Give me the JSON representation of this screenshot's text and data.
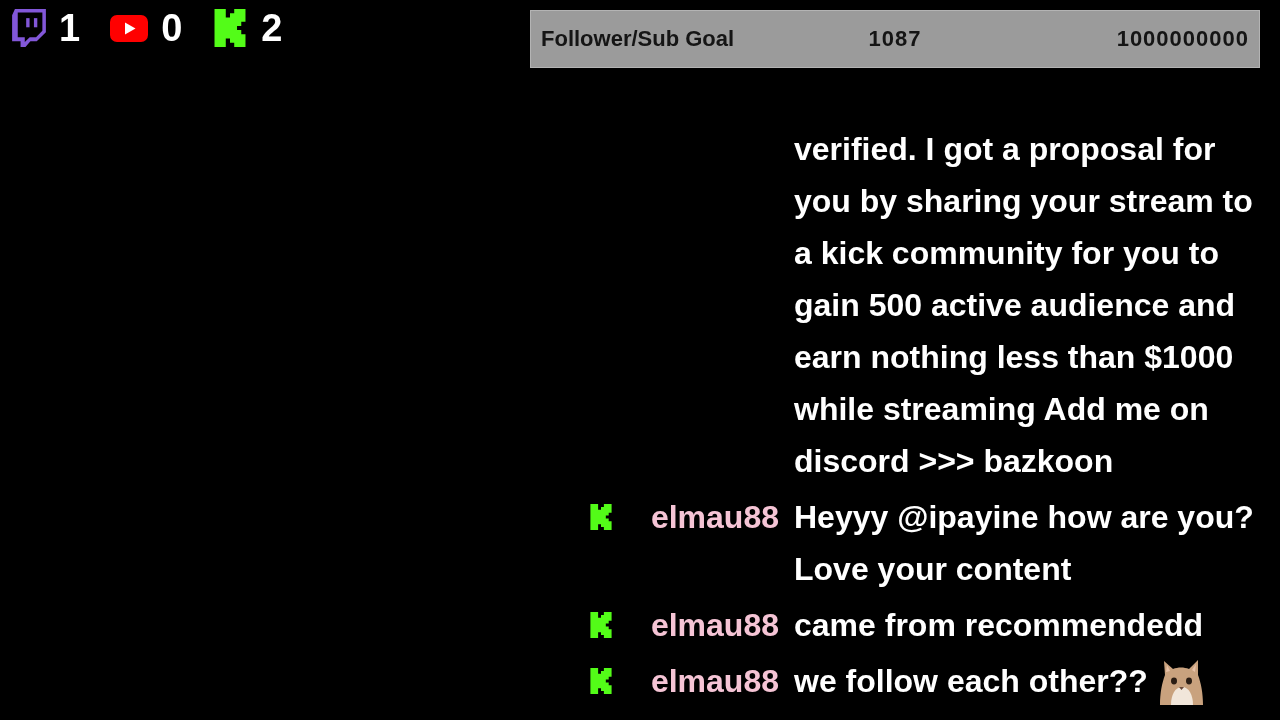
{
  "counters": [
    {
      "kind": "twitch",
      "count": "1"
    },
    {
      "kind": "youtube",
      "count": "0"
    },
    {
      "kind": "kick",
      "count": "2"
    }
  ],
  "goal": {
    "label": "Follower/Sub Goal",
    "current": "1087",
    "target": "1000000000"
  },
  "chat": {
    "messages": [
      {
        "text": "verified. I got a proposal for you by sharing your stream to a kick community for you to gain 500 active audience and earn nothing less than $1000 while streaming Add me on discord >>> bazkoon",
        "emote": false
      },
      {
        "kind": "kick",
        "username": "elmau88",
        "text": "Heyyy @ipayine how are you? Love your content",
        "emote": false
      },
      {
        "kind": "kick",
        "username": "elmau88",
        "text": "came from recommendedd",
        "emote": false
      },
      {
        "kind": "kick",
        "username": "elmau88",
        "text": "we follow each other??",
        "emote": true
      }
    ]
  }
}
